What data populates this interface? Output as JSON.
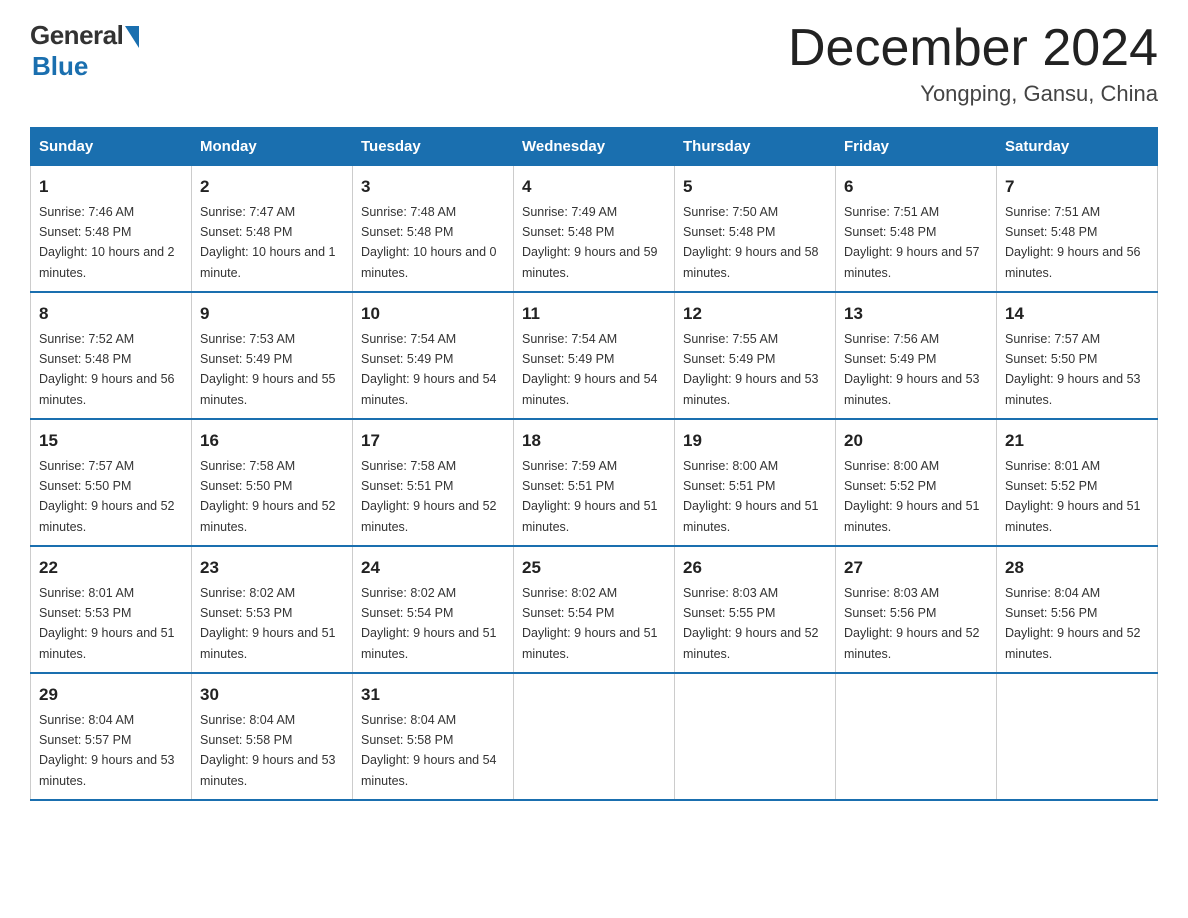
{
  "logo": {
    "general": "General",
    "blue": "Blue"
  },
  "title": "December 2024",
  "subtitle": "Yongping, Gansu, China",
  "days_of_week": [
    "Sunday",
    "Monday",
    "Tuesday",
    "Wednesday",
    "Thursday",
    "Friday",
    "Saturday"
  ],
  "weeks": [
    [
      {
        "day": "1",
        "sunrise": "7:46 AM",
        "sunset": "5:48 PM",
        "daylight": "10 hours and 2 minutes."
      },
      {
        "day": "2",
        "sunrise": "7:47 AM",
        "sunset": "5:48 PM",
        "daylight": "10 hours and 1 minute."
      },
      {
        "day": "3",
        "sunrise": "7:48 AM",
        "sunset": "5:48 PM",
        "daylight": "10 hours and 0 minutes."
      },
      {
        "day": "4",
        "sunrise": "7:49 AM",
        "sunset": "5:48 PM",
        "daylight": "9 hours and 59 minutes."
      },
      {
        "day": "5",
        "sunrise": "7:50 AM",
        "sunset": "5:48 PM",
        "daylight": "9 hours and 58 minutes."
      },
      {
        "day": "6",
        "sunrise": "7:51 AM",
        "sunset": "5:48 PM",
        "daylight": "9 hours and 57 minutes."
      },
      {
        "day": "7",
        "sunrise": "7:51 AM",
        "sunset": "5:48 PM",
        "daylight": "9 hours and 56 minutes."
      }
    ],
    [
      {
        "day": "8",
        "sunrise": "7:52 AM",
        "sunset": "5:48 PM",
        "daylight": "9 hours and 56 minutes."
      },
      {
        "day": "9",
        "sunrise": "7:53 AM",
        "sunset": "5:49 PM",
        "daylight": "9 hours and 55 minutes."
      },
      {
        "day": "10",
        "sunrise": "7:54 AM",
        "sunset": "5:49 PM",
        "daylight": "9 hours and 54 minutes."
      },
      {
        "day": "11",
        "sunrise": "7:54 AM",
        "sunset": "5:49 PM",
        "daylight": "9 hours and 54 minutes."
      },
      {
        "day": "12",
        "sunrise": "7:55 AM",
        "sunset": "5:49 PM",
        "daylight": "9 hours and 53 minutes."
      },
      {
        "day": "13",
        "sunrise": "7:56 AM",
        "sunset": "5:49 PM",
        "daylight": "9 hours and 53 minutes."
      },
      {
        "day": "14",
        "sunrise": "7:57 AM",
        "sunset": "5:50 PM",
        "daylight": "9 hours and 53 minutes."
      }
    ],
    [
      {
        "day": "15",
        "sunrise": "7:57 AM",
        "sunset": "5:50 PM",
        "daylight": "9 hours and 52 minutes."
      },
      {
        "day": "16",
        "sunrise": "7:58 AM",
        "sunset": "5:50 PM",
        "daylight": "9 hours and 52 minutes."
      },
      {
        "day": "17",
        "sunrise": "7:58 AM",
        "sunset": "5:51 PM",
        "daylight": "9 hours and 52 minutes."
      },
      {
        "day": "18",
        "sunrise": "7:59 AM",
        "sunset": "5:51 PM",
        "daylight": "9 hours and 51 minutes."
      },
      {
        "day": "19",
        "sunrise": "8:00 AM",
        "sunset": "5:51 PM",
        "daylight": "9 hours and 51 minutes."
      },
      {
        "day": "20",
        "sunrise": "8:00 AM",
        "sunset": "5:52 PM",
        "daylight": "9 hours and 51 minutes."
      },
      {
        "day": "21",
        "sunrise": "8:01 AM",
        "sunset": "5:52 PM",
        "daylight": "9 hours and 51 minutes."
      }
    ],
    [
      {
        "day": "22",
        "sunrise": "8:01 AM",
        "sunset": "5:53 PM",
        "daylight": "9 hours and 51 minutes."
      },
      {
        "day": "23",
        "sunrise": "8:02 AM",
        "sunset": "5:53 PM",
        "daylight": "9 hours and 51 minutes."
      },
      {
        "day": "24",
        "sunrise": "8:02 AM",
        "sunset": "5:54 PM",
        "daylight": "9 hours and 51 minutes."
      },
      {
        "day": "25",
        "sunrise": "8:02 AM",
        "sunset": "5:54 PM",
        "daylight": "9 hours and 51 minutes."
      },
      {
        "day": "26",
        "sunrise": "8:03 AM",
        "sunset": "5:55 PM",
        "daylight": "9 hours and 52 minutes."
      },
      {
        "day": "27",
        "sunrise": "8:03 AM",
        "sunset": "5:56 PM",
        "daylight": "9 hours and 52 minutes."
      },
      {
        "day": "28",
        "sunrise": "8:04 AM",
        "sunset": "5:56 PM",
        "daylight": "9 hours and 52 minutes."
      }
    ],
    [
      {
        "day": "29",
        "sunrise": "8:04 AM",
        "sunset": "5:57 PM",
        "daylight": "9 hours and 53 minutes."
      },
      {
        "day": "30",
        "sunrise": "8:04 AM",
        "sunset": "5:58 PM",
        "daylight": "9 hours and 53 minutes."
      },
      {
        "day": "31",
        "sunrise": "8:04 AM",
        "sunset": "5:58 PM",
        "daylight": "9 hours and 54 minutes."
      },
      null,
      null,
      null,
      null
    ]
  ],
  "labels": {
    "sunrise": "Sunrise:",
    "sunset": "Sunset:",
    "daylight": "Daylight:"
  }
}
